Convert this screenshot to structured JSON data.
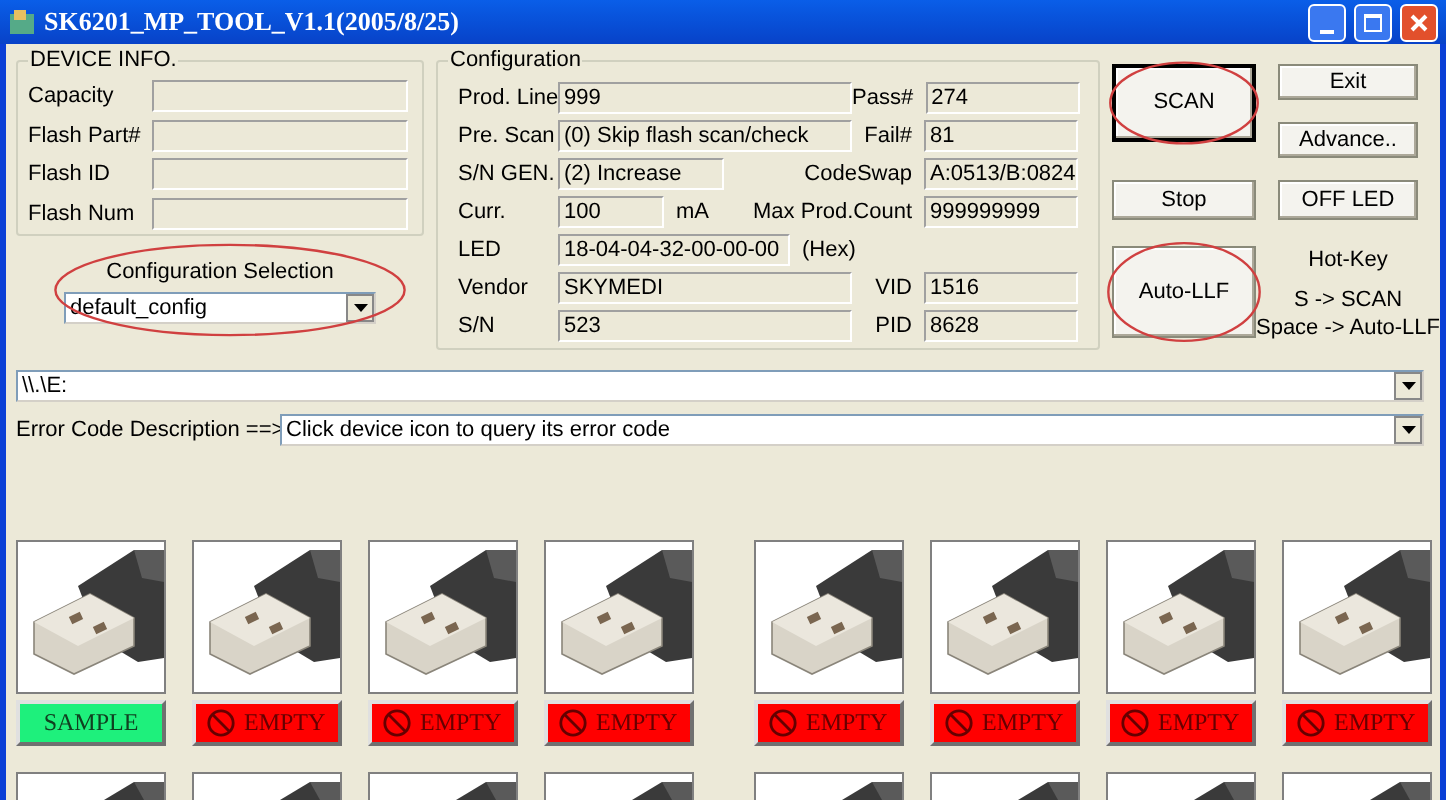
{
  "window": {
    "title": "SK6201_MP_TOOL_V1.1(2005/8/25)"
  },
  "device_info": {
    "title": "DEVICE INFO.",
    "fields": [
      {
        "label": "Capacity"
      },
      {
        "label": "Flash Part#"
      },
      {
        "label": "Flash ID"
      },
      {
        "label": "Flash Num"
      }
    ]
  },
  "configuration_selection": {
    "label": "Configuration Selection",
    "value": "default_config",
    "circled": true
  },
  "configuration": {
    "title": "Configuration",
    "rows": [
      {
        "left": {
          "label": "Prod. Line",
          "value": "999"
        },
        "right": {
          "label": "Pass#",
          "value": "274"
        }
      },
      {
        "left": {
          "label": "Pre. Scan",
          "value": "(0) Skip flash scan/check"
        },
        "right": {
          "label": "Fail#",
          "value": "81"
        }
      },
      {
        "left": {
          "label": "S/N GEN.",
          "value": "(2) Increase"
        },
        "right": {
          "label": "CodeSwap",
          "value": "A:0513/B:0824"
        }
      },
      {
        "left": {
          "label": "Curr.",
          "value": "100",
          "unit": "mA"
        },
        "right": {
          "label": "Max Prod.Count",
          "value": "999999999"
        }
      },
      {
        "left": {
          "label": "LED",
          "value": "18-04-04-32-00-00-00",
          "unit": "(Hex)"
        }
      },
      {
        "left": {
          "label": "Vendor",
          "value": "SKYMEDI"
        },
        "right": {
          "label": "VID",
          "value": "1516"
        }
      },
      {
        "left": {
          "label": "S/N",
          "value": "523"
        },
        "right": {
          "label": "PID",
          "value": "8628"
        }
      }
    ]
  },
  "buttons": {
    "scan": {
      "label": "SCAN",
      "circled": true
    },
    "stop": {
      "label": "Stop"
    },
    "auto_llf": {
      "label": "Auto-LLF",
      "circled": true
    },
    "exit": {
      "label": "Exit"
    },
    "advance": {
      "label": "Advance.."
    },
    "off_led": {
      "label": "OFF LED"
    }
  },
  "hot_key": {
    "title": "Hot-Key",
    "lines": [
      "S -> SCAN",
      "Space -> Auto-LLF"
    ]
  },
  "drive_path": {
    "value": "\\\\.\\E:"
  },
  "error_code": {
    "label": "Error Code Description ==>",
    "value": "Click device icon to query its error code"
  },
  "slot_rows": [
    {
      "slots": [
        {
          "kind": "sample",
          "label": "SAMPLE"
        },
        {
          "kind": "empty",
          "label": "EMPTY"
        },
        {
          "kind": "empty",
          "label": "EMPTY"
        },
        {
          "kind": "empty",
          "label": "EMPTY"
        },
        {
          "kind": "empty",
          "label": "EMPTY"
        },
        {
          "kind": "empty",
          "label": "EMPTY"
        },
        {
          "kind": "empty",
          "label": "EMPTY"
        },
        {
          "kind": "empty",
          "label": "EMPTY"
        }
      ]
    },
    {
      "slots": [
        {
          "kind": "blank"
        },
        {
          "kind": "blank"
        },
        {
          "kind": "blank"
        },
        {
          "kind": "blank"
        },
        {
          "kind": "blank"
        },
        {
          "kind": "blank"
        },
        {
          "kind": "blank"
        },
        {
          "kind": "blank"
        }
      ]
    }
  ]
}
